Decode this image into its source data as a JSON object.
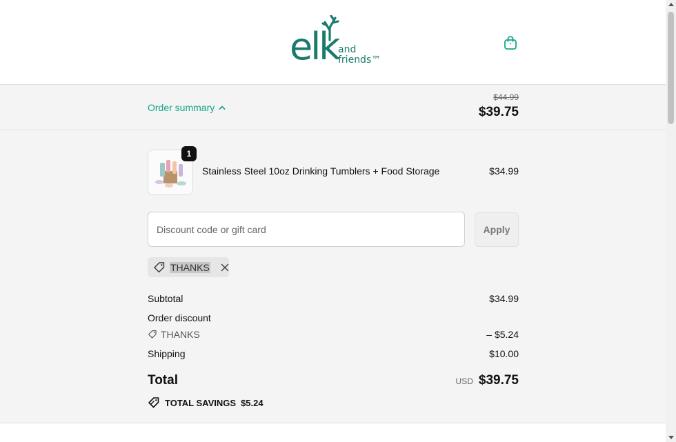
{
  "header": {
    "logo": {
      "main": "elk",
      "sub_line1": "and",
      "sub_line2": "friends™"
    },
    "cart_icon": "shopping-bag-icon"
  },
  "summary": {
    "toggle_label": "Order summary",
    "toggle_icon": "chevron-up-icon",
    "compare_price": "$44.99",
    "total": "$39.75"
  },
  "product": {
    "quantity": "1",
    "name": "Stainless Steel 10oz Drinking Tumblers + Food Storage",
    "price": "$34.99"
  },
  "discount": {
    "placeholder": "Discount code or gift card",
    "value": "",
    "apply_label": "Apply",
    "applied_code": "THANKS"
  },
  "totals": {
    "subtotal_label": "Subtotal",
    "subtotal_value": "$34.99",
    "order_discount_label": "Order discount",
    "discount_code": "THANKS",
    "discount_value": "– $5.24",
    "shipping_label": "Shipping",
    "shipping_value": "$10.00",
    "total_label": "Total",
    "currency": "USD",
    "total_value": "$39.75",
    "savings_label": "TOTAL SAVINGS",
    "savings_value": "$5.24"
  },
  "colors": {
    "accent": "#14a58a",
    "logo": "#1a7a6c",
    "panel": "#f4f4f4"
  }
}
